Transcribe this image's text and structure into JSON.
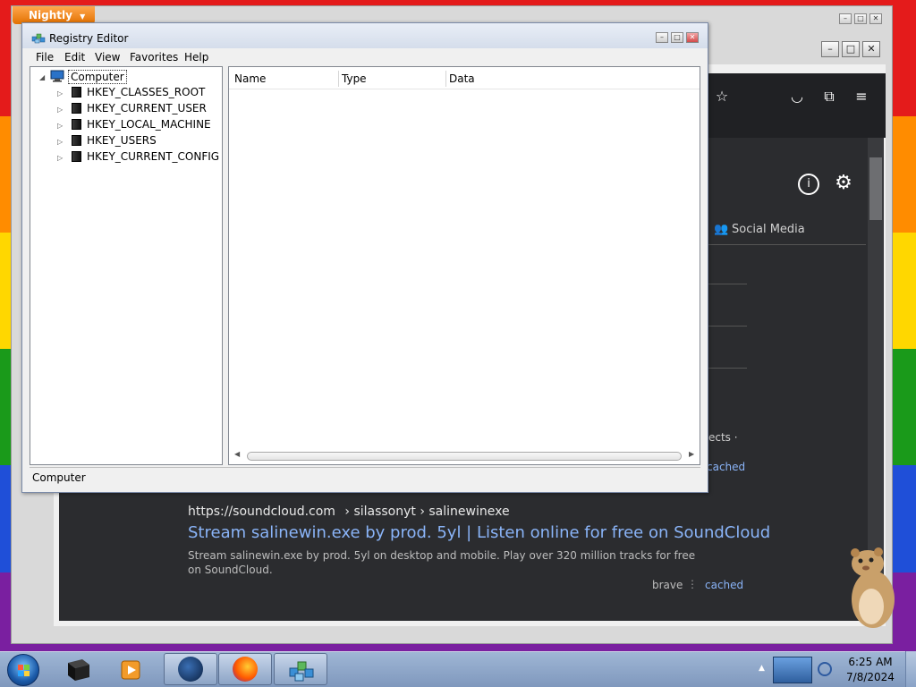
{
  "nightly": {
    "badge": "Nightly"
  },
  "brave": {
    "tab_social": "Social Media",
    "frag_effects": "ects ·",
    "frag_cached": "cached",
    "result": {
      "url": "https://soundcloud.com",
      "breadcrumb": "› silassonyt › salinewinexe",
      "title": "Stream salinewin.exe by prod. 5yl | Listen online for free on SoundCloud",
      "snippet": "Stream salinewin.exe by prod. 5yl on desktop and mobile. Play over 320 million tracks for free on SoundCloud.",
      "source": "brave",
      "cached": "cached"
    }
  },
  "regedit": {
    "title": "Registry Editor",
    "menu": [
      "File",
      "Edit",
      "View",
      "Favorites",
      "Help"
    ],
    "tree": {
      "root": "Computer",
      "children": [
        "HKEY_CLASSES_ROOT",
        "HKEY_CURRENT_USER",
        "HKEY_LOCAL_MACHINE",
        "HKEY_USERS",
        "HKEY_CURRENT_CONFIG"
      ]
    },
    "columns": [
      "Name",
      "Type",
      "Data"
    ],
    "status": "Computer"
  },
  "taskbar": {
    "time": "6:25 AM",
    "date": "7/8/2024"
  },
  "colors": {
    "nightly_orange": "#e27100",
    "brave_bg": "#2b2c2f",
    "link_blue": "#8ab4f8",
    "title_bar": "#d3dcea"
  }
}
